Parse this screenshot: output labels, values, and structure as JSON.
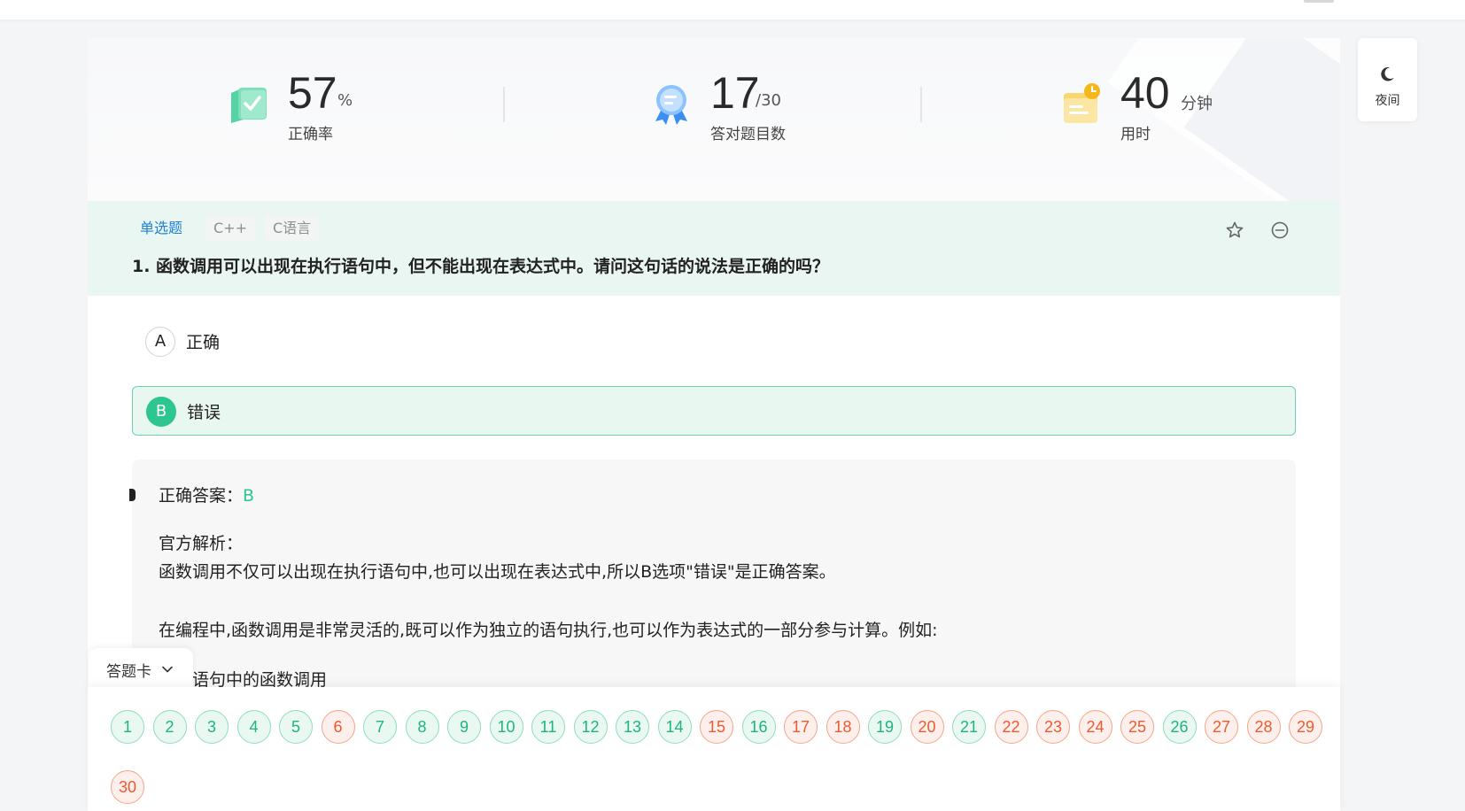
{
  "stats": {
    "accuracy": {
      "value": "57",
      "unit": "%",
      "label": "正确率"
    },
    "correct": {
      "value": "17",
      "unit": "/30",
      "label": "答对题目数"
    },
    "time": {
      "value": "40",
      "unit": "分钟",
      "label": "用时"
    }
  },
  "question": {
    "type": "单选题",
    "tags": [
      "C++",
      "C语言"
    ],
    "title": "1. 函数调用可以出现在执行语句中，但不能出现在表达式中。请问这句话的说法是正确的吗？"
  },
  "options": [
    {
      "letter": "A",
      "text": "正确",
      "selected": false
    },
    {
      "letter": "B",
      "text": "错误",
      "selected": true
    }
  ],
  "analysis": {
    "answer_label": "正确答案：",
    "answer_value": "B",
    "title": "官方解析：",
    "p1": "函数调用不仅可以出现在执行语句中,也可以出现在表达式中,所以B选项\"错误\"是正确答案。",
    "p2": "在编程中,函数调用是非常灵活的,既可以作为独立的语句执行,也可以作为表达式的一部分参与计算。例如:",
    "p3": "执行语句中的函数调用"
  },
  "night_mode": {
    "label": "夜间"
  },
  "answer_card": {
    "label": "答题卡",
    "numbers": [
      {
        "n": "1",
        "status": "correct"
      },
      {
        "n": "2",
        "status": "correct"
      },
      {
        "n": "3",
        "status": "correct"
      },
      {
        "n": "4",
        "status": "correct"
      },
      {
        "n": "5",
        "status": "correct"
      },
      {
        "n": "6",
        "status": "wrong"
      },
      {
        "n": "7",
        "status": "correct"
      },
      {
        "n": "8",
        "status": "correct"
      },
      {
        "n": "9",
        "status": "correct"
      },
      {
        "n": "10",
        "status": "correct"
      },
      {
        "n": "11",
        "status": "correct"
      },
      {
        "n": "12",
        "status": "correct"
      },
      {
        "n": "13",
        "status": "correct"
      },
      {
        "n": "14",
        "status": "correct"
      },
      {
        "n": "15",
        "status": "wrong"
      },
      {
        "n": "16",
        "status": "correct"
      },
      {
        "n": "17",
        "status": "wrong"
      },
      {
        "n": "18",
        "status": "wrong"
      },
      {
        "n": "19",
        "status": "correct"
      },
      {
        "n": "20",
        "status": "wrong"
      },
      {
        "n": "21",
        "status": "correct"
      },
      {
        "n": "22",
        "status": "wrong"
      },
      {
        "n": "23",
        "status": "wrong"
      },
      {
        "n": "24",
        "status": "wrong"
      },
      {
        "n": "25",
        "status": "wrong"
      },
      {
        "n": "26",
        "status": "correct"
      },
      {
        "n": "27",
        "status": "wrong"
      },
      {
        "n": "28",
        "status": "wrong"
      },
      {
        "n": "29",
        "status": "wrong"
      },
      {
        "n": "30",
        "status": "wrong"
      }
    ]
  },
  "colors": {
    "accent_green": "#2ec690",
    "wrong_orange": "#ee5a2e",
    "tag_blue": "#1e7fd8"
  }
}
